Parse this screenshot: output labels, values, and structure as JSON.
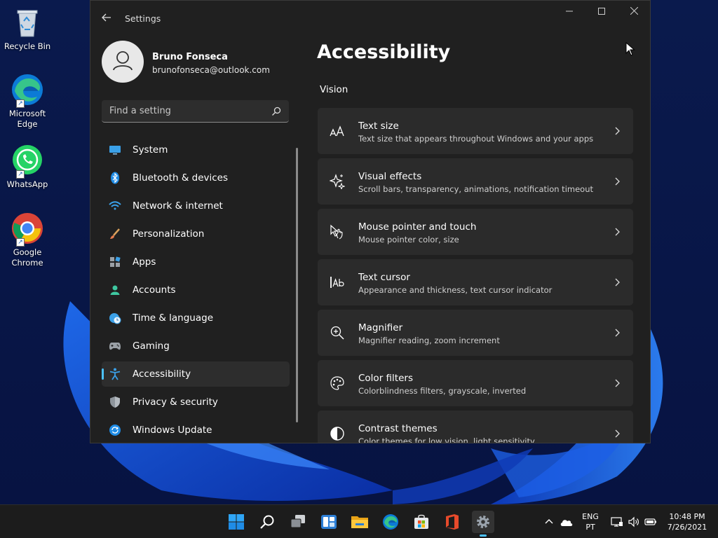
{
  "desktop": {
    "icons": [
      {
        "label": "Recycle Bin"
      },
      {
        "label": "Microsoft Edge"
      },
      {
        "label": "WhatsApp"
      },
      {
        "label": "Google Chrome"
      }
    ]
  },
  "window": {
    "title": "Settings"
  },
  "profile": {
    "name": "Bruno Fonseca",
    "email": "brunofonseca@outlook.com"
  },
  "search": {
    "placeholder": "Find a setting"
  },
  "nav": {
    "items": [
      {
        "label": "System",
        "icon": "display-icon"
      },
      {
        "label": "Bluetooth & devices",
        "icon": "bluetooth-icon"
      },
      {
        "label": "Network & internet",
        "icon": "wifi-icon"
      },
      {
        "label": "Personalization",
        "icon": "brush-icon"
      },
      {
        "label": "Apps",
        "icon": "apps-icon"
      },
      {
        "label": "Accounts",
        "icon": "person-icon"
      },
      {
        "label": "Time & language",
        "icon": "globe-clock-icon"
      },
      {
        "label": "Gaming",
        "icon": "gamepad-icon"
      },
      {
        "label": "Accessibility",
        "icon": "accessibility-icon",
        "selected": true
      },
      {
        "label": "Privacy & security",
        "icon": "shield-icon"
      },
      {
        "label": "Windows Update",
        "icon": "update-icon"
      }
    ]
  },
  "main": {
    "title": "Accessibility",
    "section": "Vision",
    "cards": [
      {
        "title": "Text size",
        "desc": "Text size that appears throughout Windows and your apps",
        "icon": "text-size-icon"
      },
      {
        "title": "Visual effects",
        "desc": "Scroll bars, transparency, animations, notification timeout",
        "icon": "sparkle-icon"
      },
      {
        "title": "Mouse pointer and touch",
        "desc": "Mouse pointer color, size",
        "icon": "pointer-touch-icon"
      },
      {
        "title": "Text cursor",
        "desc": "Appearance and thickness, text cursor indicator",
        "icon": "text-cursor-icon"
      },
      {
        "title": "Magnifier",
        "desc": "Magnifier reading, zoom increment",
        "icon": "magnifier-icon"
      },
      {
        "title": "Color filters",
        "desc": "Colorblindness filters, grayscale, inverted",
        "icon": "palette-icon"
      },
      {
        "title": "Contrast themes",
        "desc": "Color themes for low vision, light sensitivity",
        "icon": "contrast-icon"
      }
    ]
  },
  "taskbar": {
    "lang_top": "ENG",
    "lang_bottom": "PT",
    "time": "10:48 PM",
    "date": "7/26/2021"
  },
  "colors": {
    "accent": "#4cc2ff",
    "window_bg": "#202020",
    "card_bg": "#2b2b2b"
  }
}
